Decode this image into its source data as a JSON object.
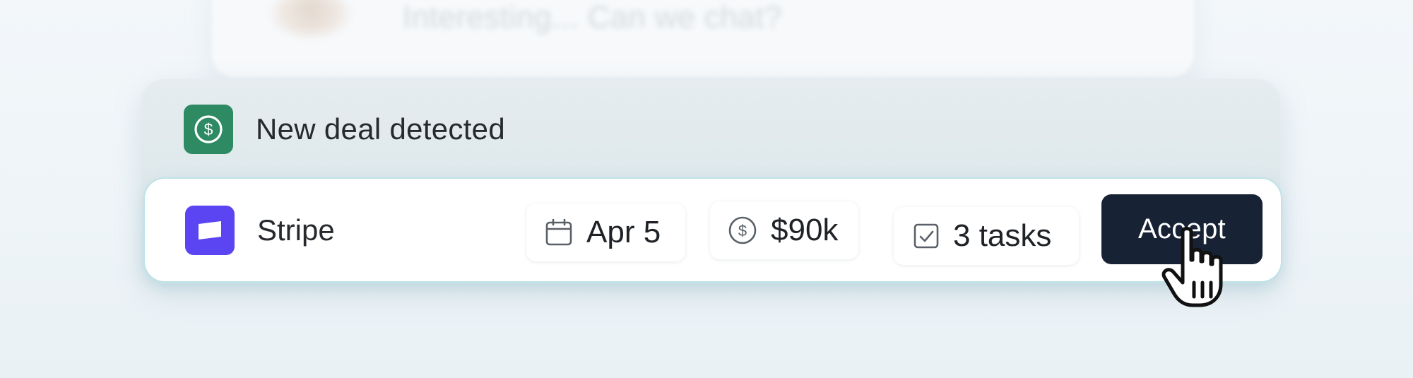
{
  "background": {
    "blurred_message": "Interesting... Can we chat?"
  },
  "notification": {
    "title": "New deal detected",
    "icon": "dollar-circle-icon",
    "accent_color": "#2e8a63"
  },
  "deal": {
    "company": "Stripe",
    "company_logo_color": "#5b45f2",
    "date": "Apr 5",
    "date_icon": "calendar-icon",
    "amount": "$90k",
    "amount_icon": "dollar-circle-icon",
    "tasks": "3 tasks",
    "tasks_icon": "checkbox-icon",
    "accept_label": "Accept",
    "accept_color": "#172235"
  }
}
